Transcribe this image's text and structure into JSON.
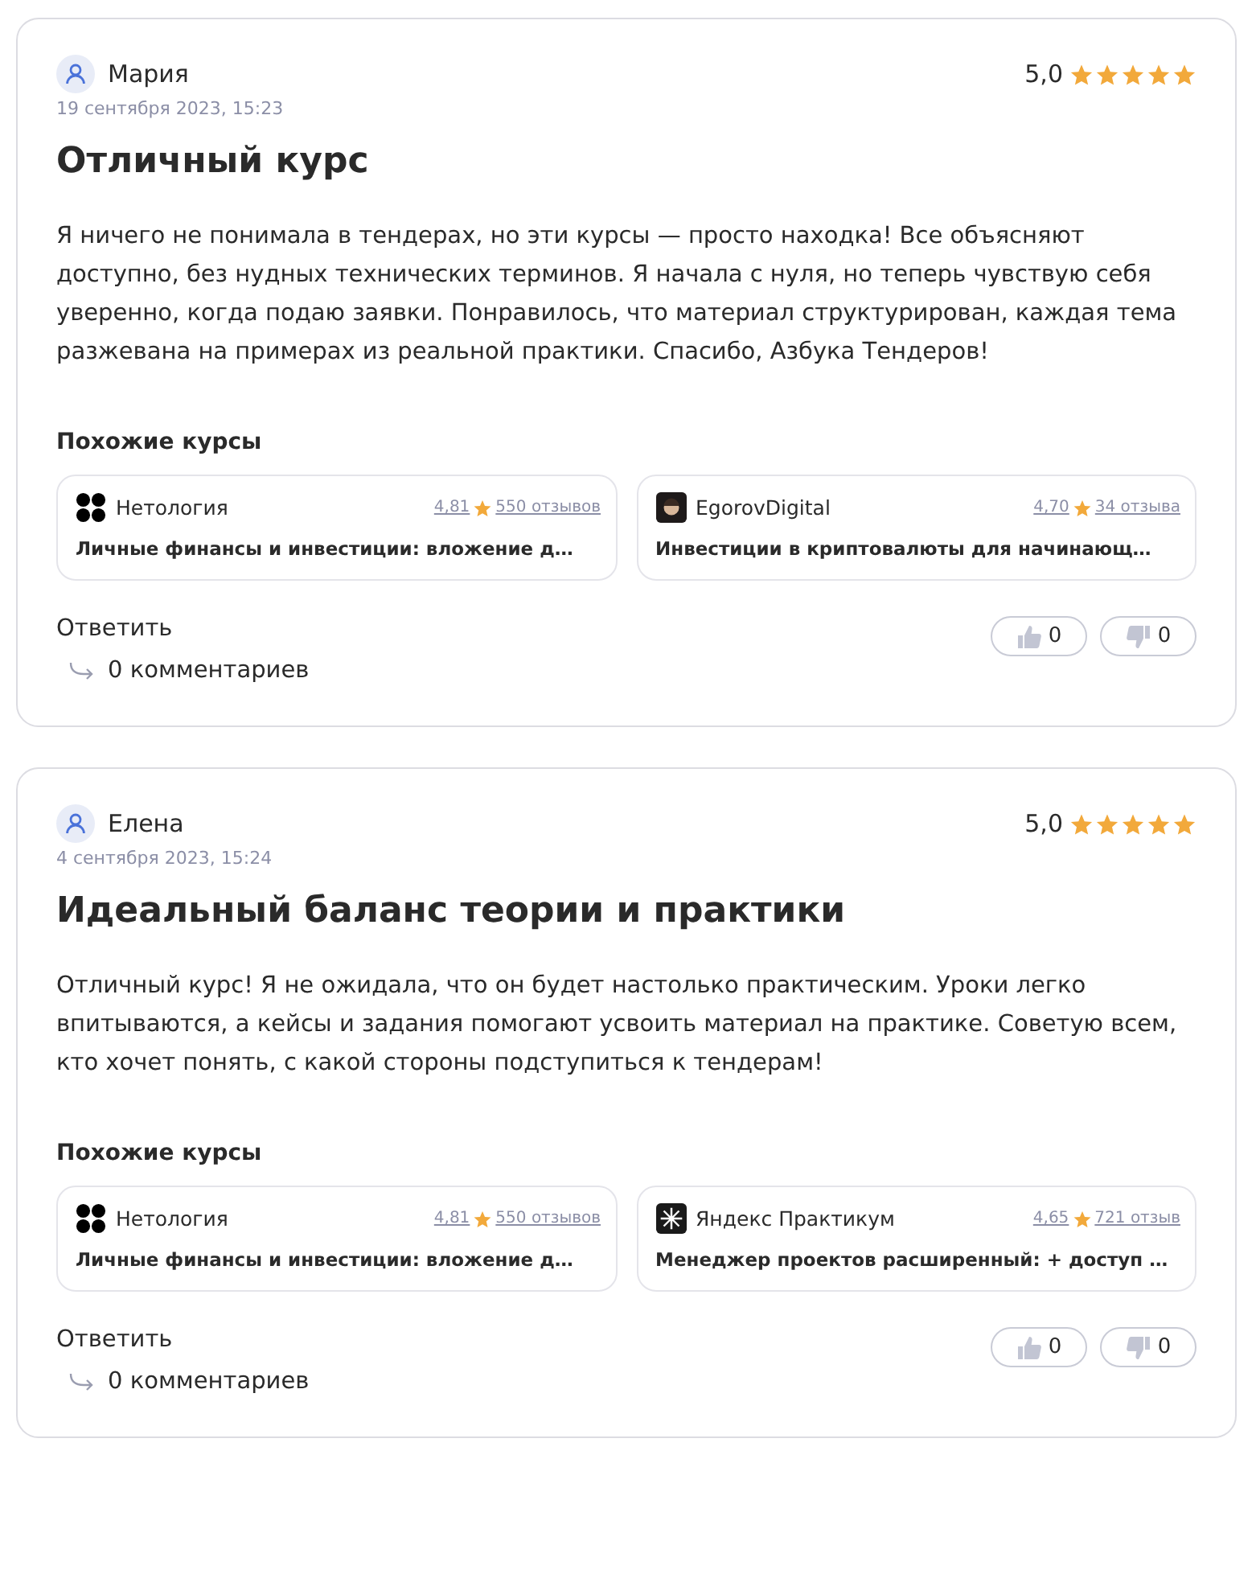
{
  "reviews": [
    {
      "author": "Мария",
      "date": "19 сентября 2023, 15:23",
      "rating": "5,0",
      "stars": 5,
      "title": "Отличный курс",
      "text": "Я ничего не понимала в тендерах, но эти курсы — просто находка! Все объясняют доступно, без нудных технических терминов. Я начала с нуля, но теперь чувствую себя уверенно, когда подаю заявки. Понравилось, что материал структурирован, каждая тема разжевана на примерах из реальной практики. Спасибо, Азбука Тендеров!",
      "similar_heading": "Похожие курсы",
      "similar": [
        {
          "school": "Нетология",
          "kind": "dots",
          "rating": "4,81",
          "reviews": "550 отзывов",
          "course": "Личные финансы и инвестиции: вложение д…"
        },
        {
          "school": "EgorovDigital",
          "kind": "dark",
          "rating": "4,70",
          "reviews": "34 отзыва",
          "course": "Инвестиции в криптовалюты для начинающ…"
        }
      ],
      "reply": "Ответить",
      "comments": "0 комментариев",
      "likes": "0",
      "dislikes": "0"
    },
    {
      "author": "Елена",
      "date": "4 сентября 2023, 15:24",
      "rating": "5,0",
      "stars": 5,
      "title": "Идеальный баланс теории и практики",
      "text": "Отличный курс! Я не ожидала, что он будет настолько практическим. Уроки легко впитываются, а кейсы и задания помогают усвоить материал на практике. Советую всем, кто хочет понять, с какой стороны подступиться к тендерам!",
      "similar_heading": "Похожие курсы",
      "similar": [
        {
          "school": "Нетология",
          "kind": "dots",
          "rating": "4,81",
          "reviews": "550 отзывов",
          "course": "Личные финансы и инвестиции: вложение д…"
        },
        {
          "school": "Яндекс Практикум",
          "kind": "burst",
          "rating": "4,65",
          "reviews": "721 отзыв",
          "course": "Менеджер проектов расширенный: + доступ …"
        }
      ],
      "reply": "Ответить",
      "comments": "0 комментариев",
      "likes": "0",
      "dislikes": "0"
    }
  ]
}
